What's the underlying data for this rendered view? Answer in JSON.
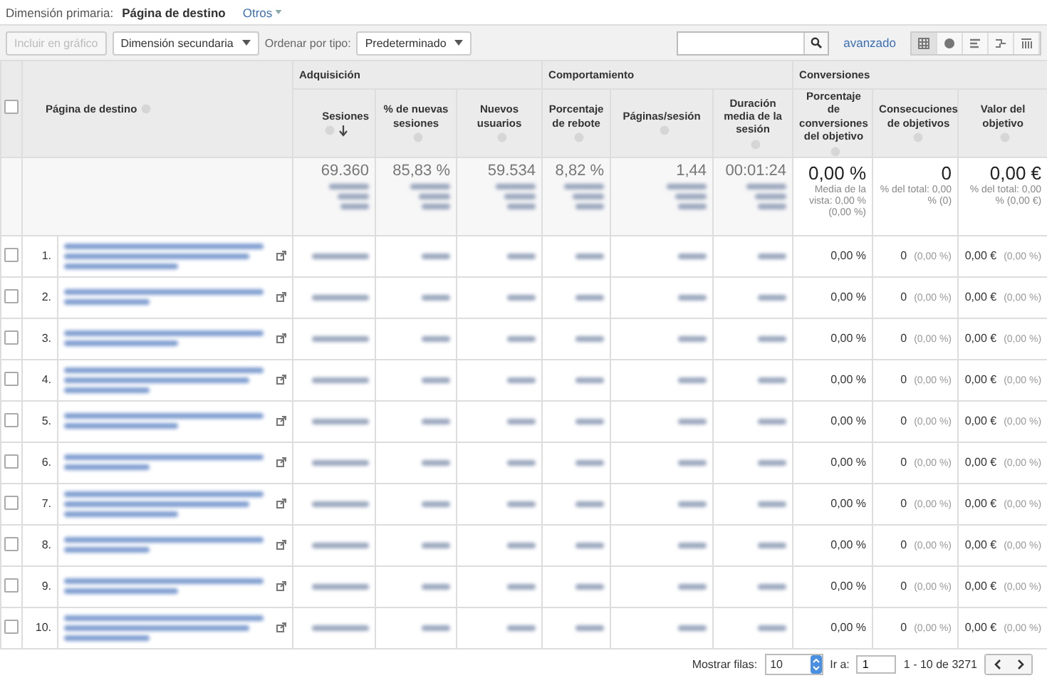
{
  "primary_dimension": {
    "label": "Dimensión primaria:",
    "value": "Página de destino",
    "other": "Otros"
  },
  "toolbar": {
    "chart_button": {
      "label": "Incluir en gráfico",
      "disabled": true
    },
    "secondary_dimension": "Dimensión secundaria",
    "sort_label": "Ordenar por tipo:",
    "sort_value": "Predeterminado",
    "advanced": "avanzado",
    "views": [
      {
        "selected": true
      },
      {
        "selected": false
      },
      {
        "selected": false
      },
      {
        "selected": false
      },
      {
        "selected": false
      }
    ]
  },
  "table": {
    "dimension_header": "Página de destino",
    "select_all_checked": false,
    "groups": [
      {
        "label": "Adquisición",
        "columns": [
          {
            "label": "Sesiones",
            "sorted": true,
            "blurred": true,
            "total": "69.360"
          },
          {
            "label": "% de nuevas sesiones",
            "sorted": false,
            "blurred": true,
            "total": "85,83 %"
          },
          {
            "label": "Nuevos usuarios",
            "sorted": false,
            "blurred": true,
            "total": "59.534"
          }
        ]
      },
      {
        "label": "Comportamiento",
        "columns": [
          {
            "label": "Porcentaje de rebote",
            "sorted": false,
            "blurred": true,
            "total": "8,82 %"
          },
          {
            "label": "Páginas/sesión",
            "sorted": false,
            "blurred": true,
            "total": "1,44"
          },
          {
            "label": "Duración media de la sesión",
            "sorted": false,
            "blurred": true,
            "total": "00:01:24"
          }
        ]
      },
      {
        "label": "Conversiones",
        "columns": [
          {
            "label": "Porcentaje de conversiones del objetivo",
            "sorted": false,
            "blurred": false,
            "total": "0,00 %",
            "total_note": "Media de la vista: 0,00 % (0,00 %)"
          },
          {
            "label": "Consecuciones de objetivos",
            "sorted": false,
            "blurred": false,
            "total": "0",
            "total_note": "% del total: 0,00 % (0)"
          },
          {
            "label": "Valor del objetivo",
            "sorted": false,
            "blurred": false,
            "total": "0,00 €",
            "total_note": "% del total: 0,00 % (0,00 €)"
          }
        ]
      }
    ],
    "rows": [
      {
        "number": "1.",
        "checked": false,
        "cells": [
          {
            "value": "0,00 %"
          },
          {
            "value": "0",
            "share": "(0,00 %)"
          },
          {
            "value": "0,00 €",
            "share": "(0,00 %)"
          }
        ]
      },
      {
        "number": "2.",
        "checked": false,
        "cells": [
          {
            "value": "0,00 %"
          },
          {
            "value": "0",
            "share": "(0,00 %)"
          },
          {
            "value": "0,00 €",
            "share": "(0,00 %)"
          }
        ]
      },
      {
        "number": "3.",
        "checked": false,
        "cells": [
          {
            "value": "0,00 %"
          },
          {
            "value": "0",
            "share": "(0,00 %)"
          },
          {
            "value": "0,00 €",
            "share": "(0,00 %)"
          }
        ]
      },
      {
        "number": "4.",
        "checked": false,
        "cells": [
          {
            "value": "0,00 %"
          },
          {
            "value": "0",
            "share": "(0,00 %)"
          },
          {
            "value": "0,00 €",
            "share": "(0,00 %)"
          }
        ]
      },
      {
        "number": "5.",
        "checked": false,
        "cells": [
          {
            "value": "0,00 %"
          },
          {
            "value": "0",
            "share": "(0,00 %)"
          },
          {
            "value": "0,00 €",
            "share": "(0,00 %)"
          }
        ]
      },
      {
        "number": "6.",
        "checked": false,
        "cells": [
          {
            "value": "0,00 %"
          },
          {
            "value": "0",
            "share": "(0,00 %)"
          },
          {
            "value": "0,00 €",
            "share": "(0,00 %)"
          }
        ]
      },
      {
        "number": "7.",
        "checked": false,
        "cells": [
          {
            "value": "0,00 %"
          },
          {
            "value": "0",
            "share": "(0,00 %)"
          },
          {
            "value": "0,00 €",
            "share": "(0,00 %)"
          }
        ]
      },
      {
        "number": "8.",
        "checked": false,
        "cells": [
          {
            "value": "0,00 %"
          },
          {
            "value": "0",
            "share": "(0,00 %)"
          },
          {
            "value": "0,00 €",
            "share": "(0,00 %)"
          }
        ]
      },
      {
        "number": "9.",
        "checked": false,
        "cells": [
          {
            "value": "0,00 %"
          },
          {
            "value": "0",
            "share": "(0,00 %)"
          },
          {
            "value": "0,00 €",
            "share": "(0,00 %)"
          }
        ]
      },
      {
        "number": "10.",
        "checked": false,
        "cells": [
          {
            "value": "0,00 %"
          },
          {
            "value": "0",
            "share": "(0,00 %)"
          },
          {
            "value": "0,00 €",
            "share": "(0,00 %)"
          }
        ]
      }
    ]
  },
  "footer": {
    "rows_label": "Mostrar filas:",
    "rows_value": "10",
    "goto_label": "Ir a:",
    "goto_value": "1",
    "range": "1 - 10 de 3271"
  }
}
